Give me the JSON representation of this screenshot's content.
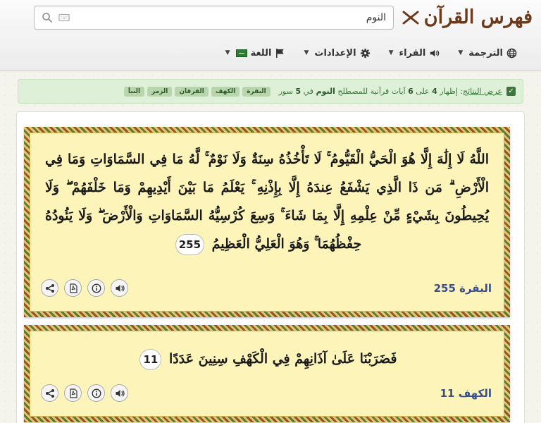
{
  "header": {
    "brand": "فهرس القرآن",
    "search": {
      "value": "النوم",
      "placeholder": ""
    },
    "nav": [
      {
        "label": "الترجمة",
        "icon": "globe-icon"
      },
      {
        "label": "القراء",
        "icon": "speaker-icon"
      },
      {
        "label": "الإعدادات",
        "icon": "gear-icon"
      },
      {
        "label": "اللغة",
        "icon": "flag-icon"
      }
    ]
  },
  "info": {
    "show_results": "عرض النتائج",
    "text_a": ": إظهار",
    "shown": "4",
    "text_b": "على",
    "total": "6",
    "text_c": "آيات قرآنية للمصطلح",
    "term": "النوم",
    "text_d": "في",
    "surah_count": "5",
    "text_e": "سور",
    "tags": [
      "البقرة",
      "الكهف",
      "الفرقان",
      "الزمر",
      "النبأ"
    ]
  },
  "results": [
    {
      "text": "اللَّهُ لَا إِلَٰهَ إِلَّا هُوَ الْحَيُّ الْقَيُّومُ ۚ لَا تَأْخُذُهُ سِنَةٌ وَلَا نَوْمٌ ۚ لَّهُ مَا فِي السَّمَاوَاتِ وَمَا فِي الْأَرْضِ ۗ مَن ذَا الَّذِي يَشْفَعُ عِندَهُ إِلَّا بِإِذْنِهِ ۚ يَعْلَمُ مَا بَيْنَ أَيْدِيهِمْ وَمَا خَلْفَهُمْ ۖ وَلَا يُحِيطُونَ بِشَيْءٍ مِّنْ عِلْمِهِ إِلَّا بِمَا شَاءَ ۚ وَسِعَ كُرْسِيُّهُ السَّمَاوَاتِ وَالْأَرْضَ ۖ وَلَا يَئُودُهُ حِفْظُهُمَا ۚ وَهُوَ الْعَلِيُّ الْعَظِيمُ",
      "ayah": "255",
      "ref": "البقرة 255"
    },
    {
      "text": "فَضَرَبْنَا عَلَىٰ آذَانِهِمْ فِي الْكَهْفِ سِنِينَ عَدَدًا",
      "ayah": "11",
      "ref": "الكهف 11"
    }
  ]
}
